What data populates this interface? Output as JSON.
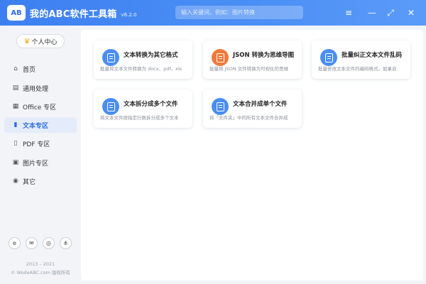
{
  "app": {
    "logo_text": "AB",
    "title": "我的ABC软件工具箱",
    "version": "v6.2.0",
    "search_placeholder": "输入关键词，例如：图片转换"
  },
  "window_controls": {
    "menu": "≡",
    "minimize": "—",
    "maximize": "⤢",
    "close": "✕"
  },
  "sidebar": {
    "user_center": "个人中心",
    "items": [
      {
        "label": "首页",
        "icon": "home-icon",
        "glyph": "⌂"
      },
      {
        "label": "通用处理",
        "icon": "general-icon",
        "glyph": "▤"
      },
      {
        "label": "Office 专区",
        "icon": "office-icon",
        "glyph": "▦"
      },
      {
        "label": "文本专区",
        "icon": "text-file-icon",
        "glyph": "▮"
      },
      {
        "label": "PDF 专区",
        "icon": "pdf-icon",
        "glyph": "▯"
      },
      {
        "label": "图片专区",
        "icon": "image-icon",
        "glyph": "▣"
      },
      {
        "label": "其它",
        "icon": "other-icon",
        "glyph": "◉"
      }
    ],
    "active_index": 3,
    "bottom_icons": [
      {
        "name": "browser-icon",
        "glyph": "e"
      },
      {
        "name": "mail-icon",
        "glyph": "✉"
      },
      {
        "name": "chat-icon",
        "glyph": "◎"
      },
      {
        "name": "share-icon",
        "glyph": "⋔"
      }
    ],
    "copyright_years": "2013 – 2021",
    "copyright_owner": "© WodeABC.com 版权所有"
  },
  "cards": [
    {
      "title": "文本转换为其它格式",
      "desc": "批量将文本文件转换为 docx、pdf、xls",
      "color": "#4a8ef2"
    },
    {
      "title": "JSON 转换为思维导图",
      "desc": "批量将 JSON 文件转换为可视化的思维",
      "color": "#f07a3a"
    },
    {
      "title": "批量纠正文本文件乱码",
      "desc": "批量修改文本文件的编码格式，如果自",
      "color": "#4a8ef2"
    },
    {
      "title": "文本拆分成多个文件",
      "desc": "将文本文件按指定行数拆分成多个文本",
      "color": "#4a8ef2"
    },
    {
      "title": "文本合并成单个文件",
      "desc": "将「文件夹」中的所有文本文件合并成",
      "color": "#4a8ef2"
    }
  ]
}
